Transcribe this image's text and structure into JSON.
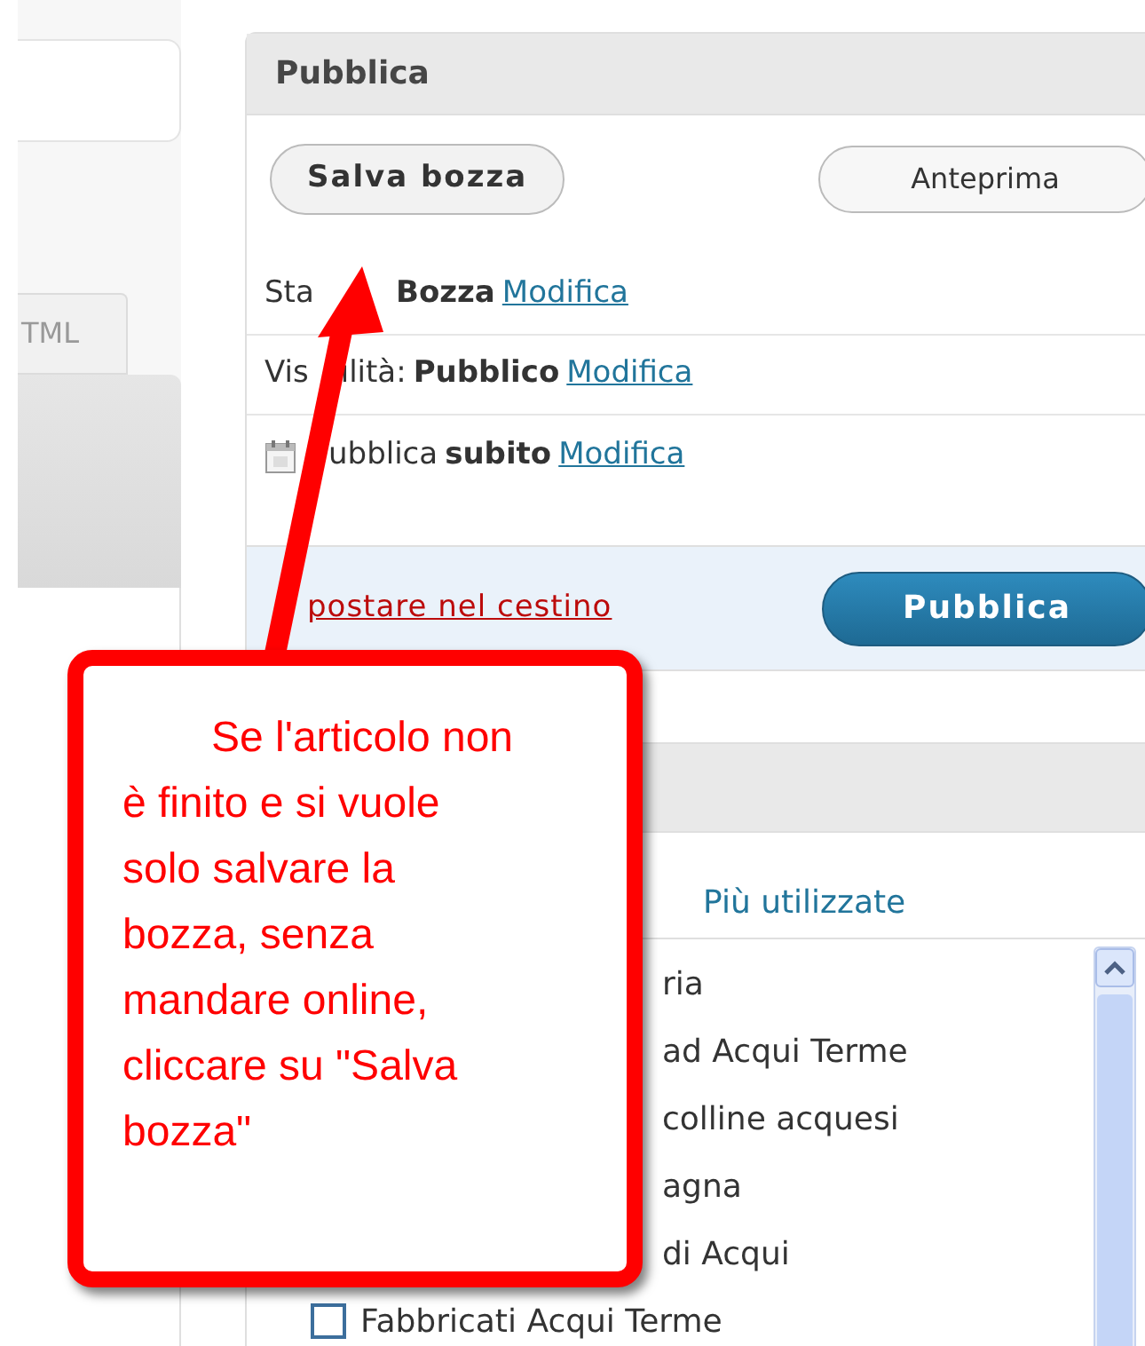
{
  "sidebar": {
    "tab": "TML"
  },
  "publish_box": {
    "title": "Pubblica",
    "buttons": [
      {
        "label": "Salva bozza",
        "kind": "primary"
      },
      {
        "label": "Anteprima",
        "kind": "secondary"
      }
    ],
    "rows": [
      {
        "kind": "status",
        "label_parts": [
          "Sta"
        ],
        "value": "Bozza",
        "link": "Modifica"
      },
      {
        "kind": "visibility",
        "label_parts": [
          "Vis",
          "ilità:"
        ],
        "value": "Pubblico",
        "link": "Modifica"
      },
      {
        "kind": "schedule",
        "label_parts": [
          "ubblica"
        ],
        "value": "subito",
        "link": "Modifica"
      }
    ],
    "trash_link": "postare nel cestino",
    "publish_button": "Pubblica"
  },
  "categories_box": {
    "tabs": [
      {
        "label": "Più utilizzate",
        "selected": false
      }
    ],
    "items": [
      {
        "label": "ria",
        "kind": "partial"
      },
      {
        "label": "ad Acqui Terme",
        "kind": "partial"
      },
      {
        "label": "colline acquesi",
        "kind": "partial"
      },
      {
        "label": "agna",
        "kind": "partial"
      },
      {
        "label": "di Acqui",
        "kind": "partial"
      },
      {
        "label": "Fabbricati Acqui Terme",
        "kind": "full",
        "checked": false
      }
    ]
  },
  "callout": {
    "text": "Se l'articolo non\nè finito e si vuole\nsolo salvare la\nbozza, senza\nmandare online,\ncliccare su \"Salva\nbozza\""
  }
}
